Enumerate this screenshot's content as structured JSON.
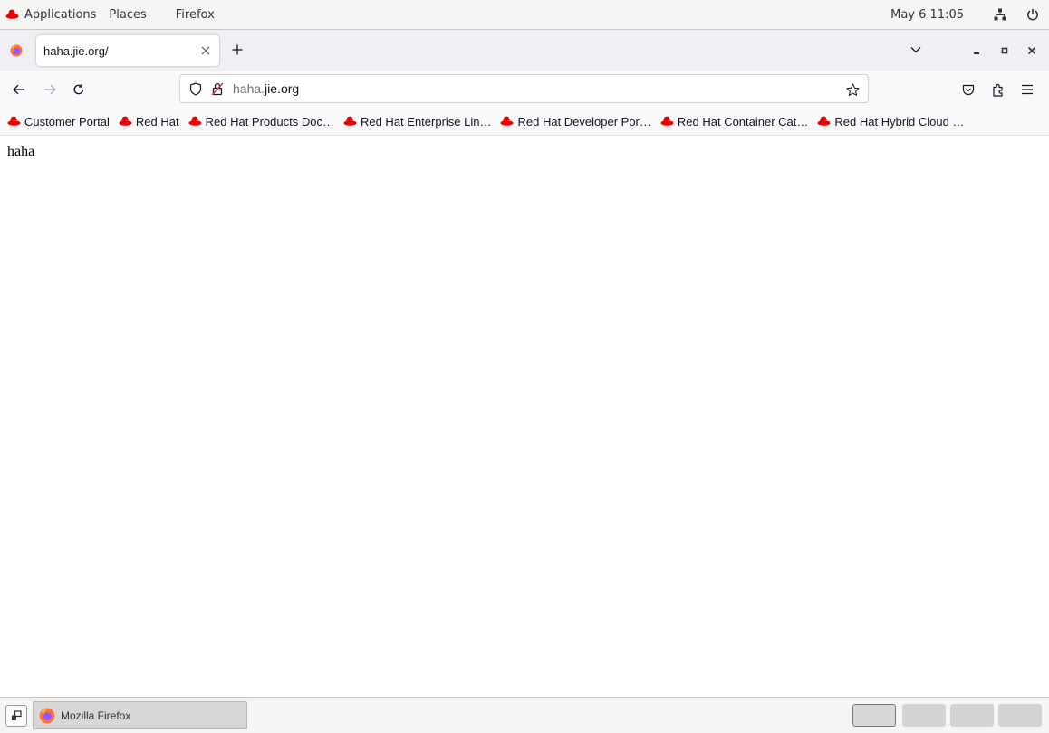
{
  "topbar": {
    "applications_label": "Applications",
    "places_label": "Places",
    "firefox_label": "Firefox",
    "clock": "May 6  11:05",
    "network_icon": "network-wired-icon",
    "power_icon": "power-icon"
  },
  "tabs": {
    "active_title": "haha.jie.org/",
    "new_tab_icon": "plus-icon",
    "list_all_tabs_icon": "chevron-down-icon"
  },
  "window_controls": {
    "minimize_label": "_",
    "maximize_label": "▫",
    "close_label": "×"
  },
  "navbar": {
    "url_subdomain": "haha.",
    "url_domain": "jie.org",
    "icons": [
      "back-arrow-icon",
      "forward-arrow-icon",
      "reload-icon",
      "shield-icon",
      "insecure-lock-icon",
      "bookmark-star-icon",
      "pocket-icon",
      "extensions-icon",
      "hamburger-menu-icon"
    ]
  },
  "bookmarks": [
    {
      "label": "Customer Portal"
    },
    {
      "label": "Red Hat"
    },
    {
      "label": "Red Hat Products Doc…"
    },
    {
      "label": "Red Hat Enterprise Lin…"
    },
    {
      "label": "Red Hat Developer Por…"
    },
    {
      "label": "Red Hat Container Cat…"
    },
    {
      "label": "Red Hat Hybrid Cloud …"
    }
  ],
  "page": {
    "body_text": "haha"
  },
  "taskbar": {
    "window_label": "Mozilla Firefox",
    "workspace_count": 4,
    "active_workspace": 1
  },
  "colors": {
    "redhat_red": "#ee0000",
    "firefox_orange": "#ff7139",
    "firefox_purple": "#9059ff"
  }
}
